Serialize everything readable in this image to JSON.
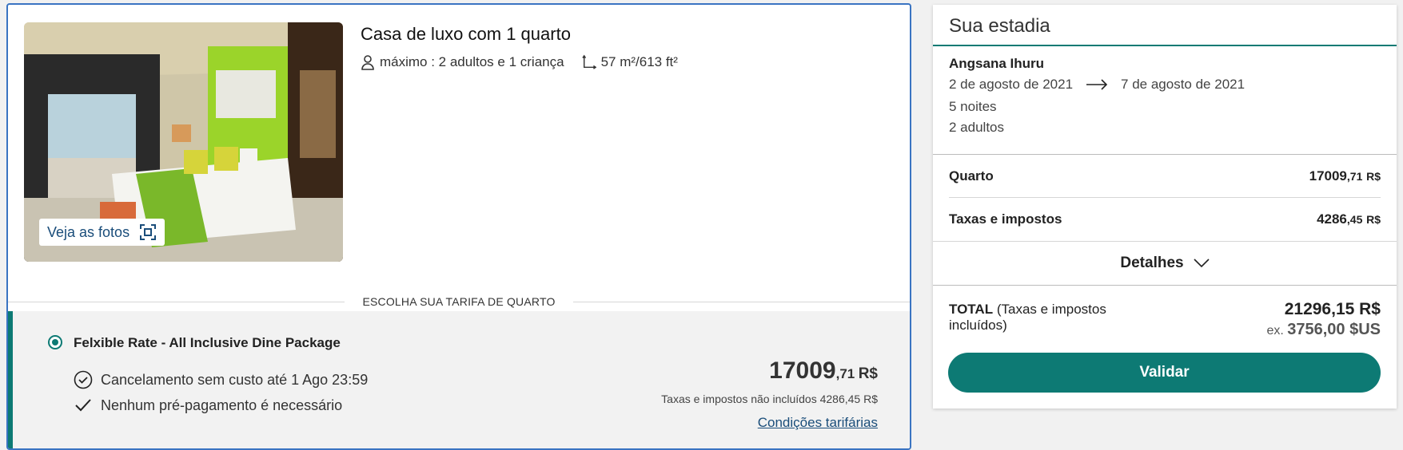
{
  "room": {
    "title": "Casa de luxo com 1 quarto",
    "occupancy": "máximo : 2 adultos e 1 criança",
    "size": "57 m²/613 ft²",
    "photos_label": "Veja as fotos",
    "rate_section_label": "ESCOLHA SUA TARIFA DE QUARTO"
  },
  "rate": {
    "name": "Felxible Rate - All Inclusive Dine Package",
    "perk_cancel": "Cancelamento sem custo até 1 Ago 23:59",
    "perk_prepay": "Nenhum pré-pagamento é necessário",
    "price_int": "17009",
    "price_dec": ",71",
    "currency": "R$",
    "tax_note": "Taxas e impostos não incluídos 4286,45 R$",
    "conditions_label": "Condições tarifárias"
  },
  "stay": {
    "title": "Sua estadia",
    "hotel": "Angsana Ihuru",
    "checkin": "2 de agosto de 2021",
    "checkout": "7 de agosto de 2021",
    "nights": "5 noites",
    "guests": "2 adultos",
    "room_label": "Quarto",
    "room_int": "17009",
    "room_dec": ",71",
    "room_cur": "R$",
    "tax_label": "Taxas e impostos",
    "tax_int": "4286",
    "tax_dec": ",45",
    "tax_cur": "R$",
    "details_label": "Detalhes",
    "total_label": "TOTAL",
    "total_note": "(Taxas e impostos incluídos)",
    "total_amount": "21296,15 R$",
    "ex_label": "ex.",
    "ex_amount": "3756,00 $US",
    "validate_label": "Validar"
  },
  "colors": {
    "accent": "#0d7a74",
    "link": "#1a4d7a",
    "card_border": "#3a74c2"
  }
}
